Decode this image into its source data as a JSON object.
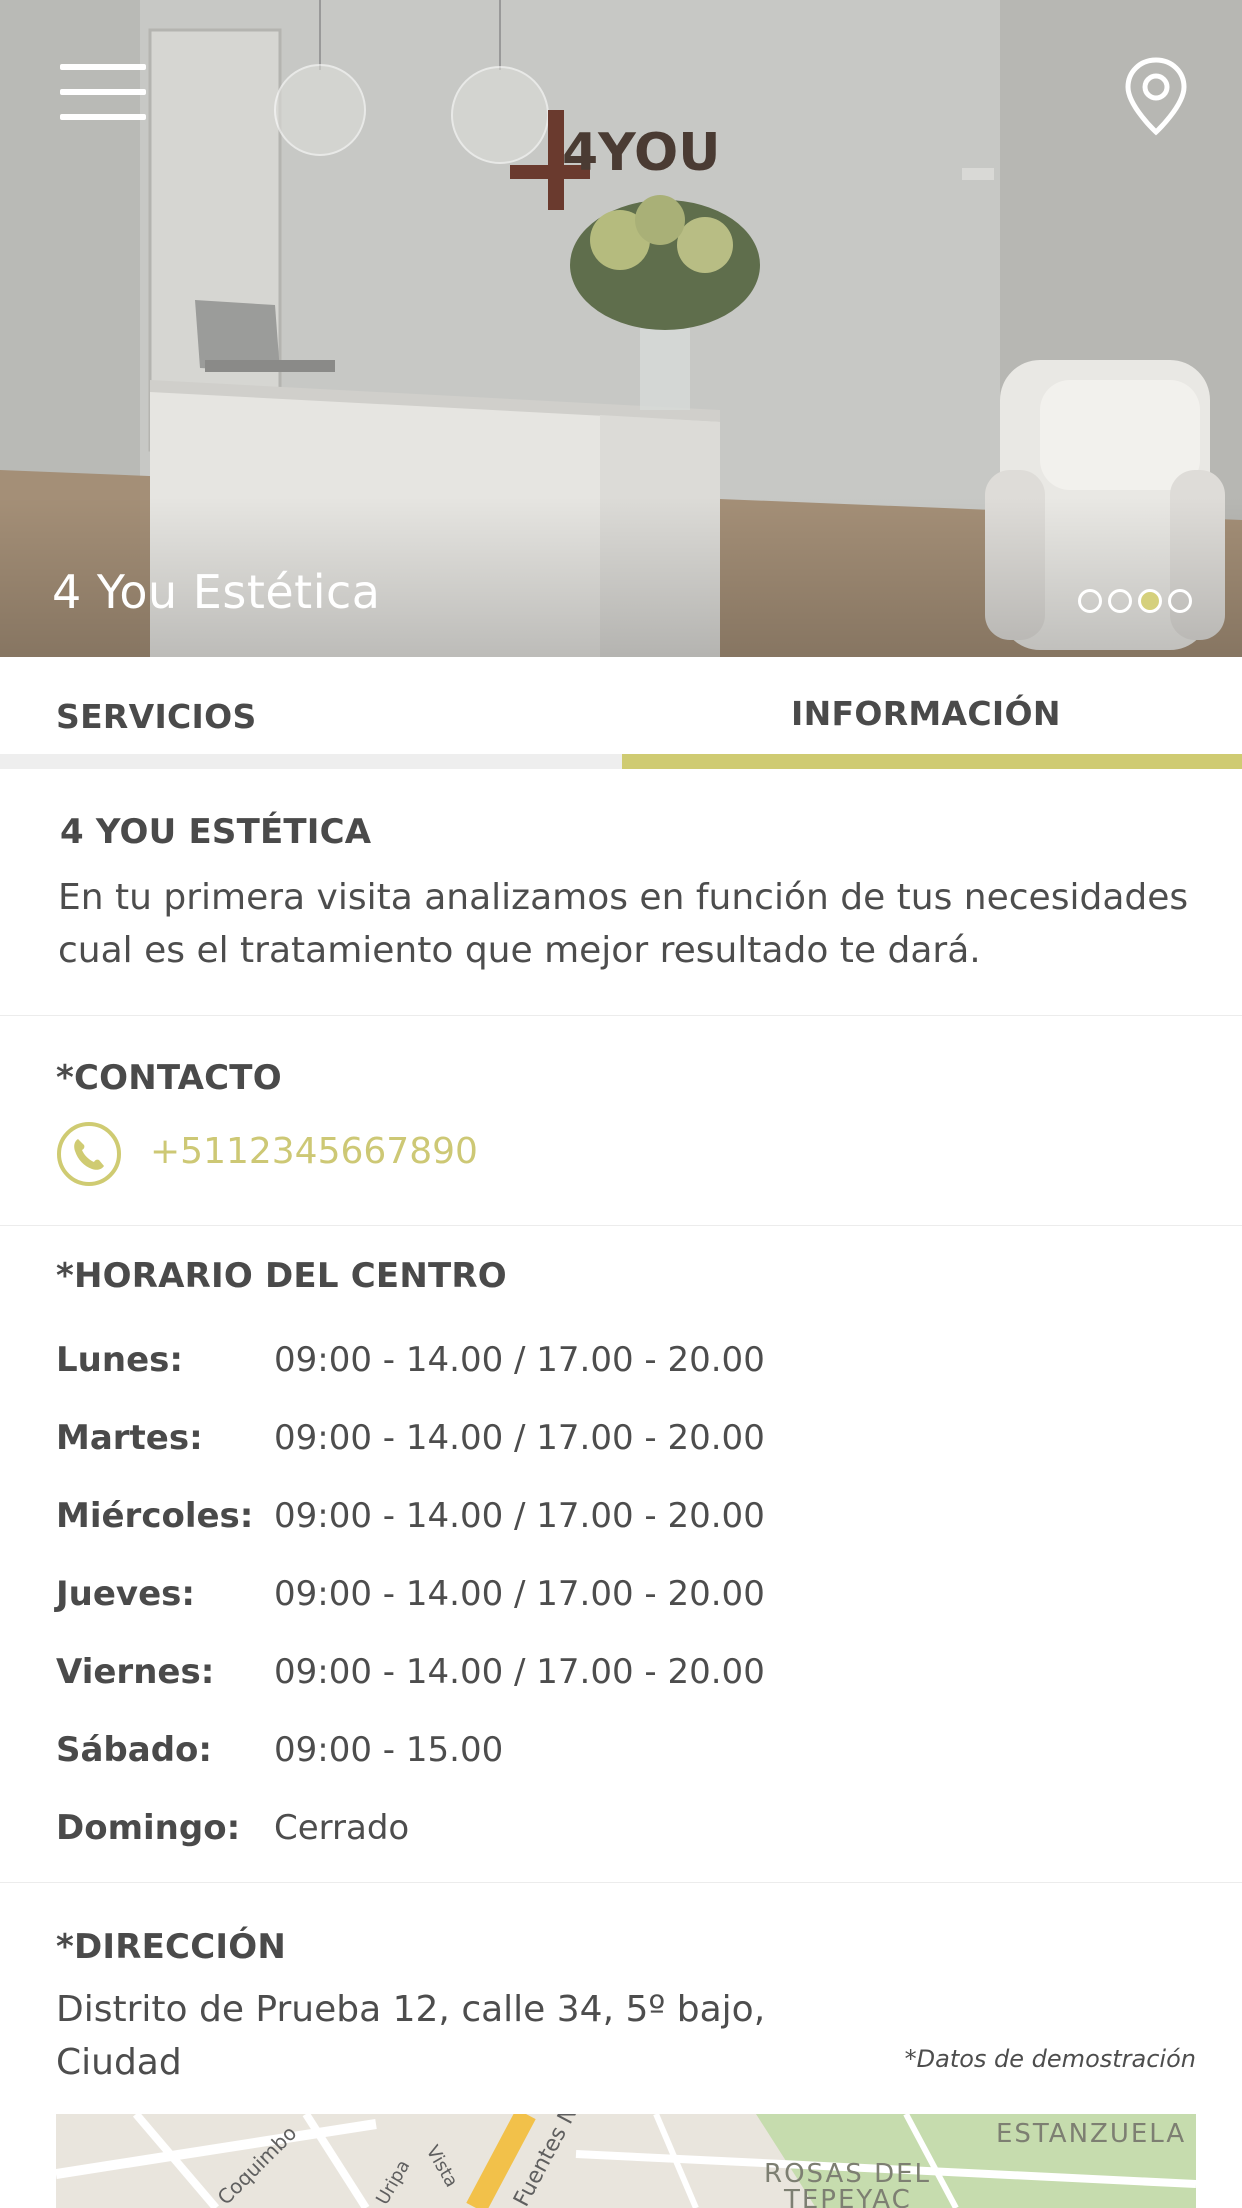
{
  "header": {
    "title": "4 You Estética",
    "logo_text": "4YOU",
    "carousel": {
      "count": 4,
      "active_index": 2
    },
    "accent_color": "#cfcb72"
  },
  "tabs": [
    {
      "label": "SERVICIOS",
      "active": false
    },
    {
      "label": "INFORMACIÓN",
      "active": true
    }
  ],
  "about": {
    "heading": "4 YOU ESTÉTICA",
    "description": "En tu primera visita analizamos en función de tus necesidades cual es el tratamiento que mejor resultado te dará."
  },
  "contact": {
    "heading": "*CONTACTO",
    "phone": "+5112345667890",
    "icon": "phone-icon"
  },
  "hours": {
    "heading": "*HORARIO DEL CENTRO",
    "rows": [
      {
        "day": "Lunes:",
        "time": "09:00 - 14.00  /  17.00 - 20.00"
      },
      {
        "day": "Martes:",
        "time": "09:00 - 14.00  /  17.00 - 20.00"
      },
      {
        "day": "Miércoles:",
        "time": "09:00 - 14.00  /  17.00 - 20.00"
      },
      {
        "day": "Jueves:",
        "time": "09:00 - 14.00  /  17.00 - 20.00"
      },
      {
        "day": "Viernes:",
        "time": "09:00 - 14.00  /  17.00 - 20.00"
      },
      {
        "day": "Sábado:",
        "time": "09:00 - 15.00"
      },
      {
        "day": "Domingo:",
        "time": "Cerrado"
      }
    ]
  },
  "address": {
    "heading": "*DIRECCIÓN",
    "line1": "Distrito de Prueba 12, calle 34, 5º bajo,",
    "line2": "Ciudad",
    "note": "*Datos de demostración"
  },
  "map": {
    "labels": [
      "ESTANZUELA",
      "ROSAS DEL",
      "TEPEYAC",
      "Coquimbo",
      "Vista",
      "Uripa",
      "Fuentes Nte"
    ]
  }
}
